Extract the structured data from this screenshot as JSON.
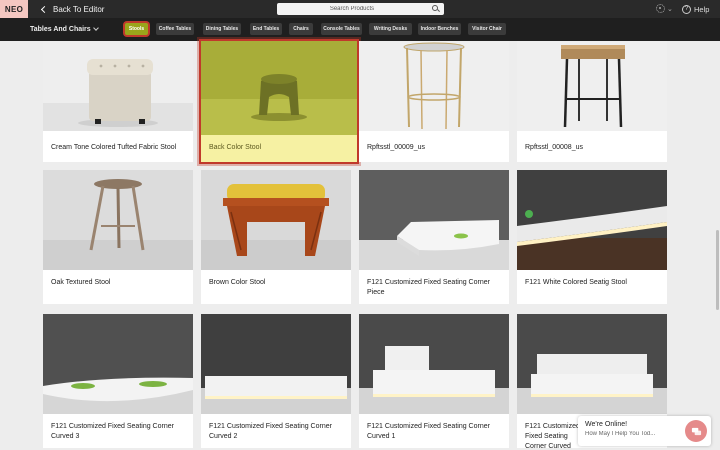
{
  "header": {
    "logo": "NEO",
    "back_label": "Back To Editor",
    "search_placeholder": "Search Products",
    "help_label": "Help"
  },
  "category_bar": {
    "selected_category": "Tables And Chairs",
    "tabs": [
      {
        "label": "Stools",
        "active": true
      },
      {
        "label": "Coffee Tables",
        "active": false
      },
      {
        "label": "Dining Tables",
        "active": false
      },
      {
        "label": "End Tables",
        "active": false
      },
      {
        "label": "Chairs",
        "active": false
      },
      {
        "label": "Console Tables",
        "active": false
      },
      {
        "label": "Writing Desks",
        "active": false
      },
      {
        "label": "Indoor Benches",
        "active": false
      },
      {
        "label": "Visitor Chair",
        "active": false
      }
    ]
  },
  "products": [
    {
      "name": "Cream Tone Colored Tufted Fabric Stool"
    },
    {
      "name": "Back Color Stool",
      "highlighted": true
    },
    {
      "name": "Rpftsstl_00009_us"
    },
    {
      "name": "Rpftsstl_00008_us"
    },
    {
      "name": "Oak Textured Stool"
    },
    {
      "name": "Brown Color Stool"
    },
    {
      "name": "F121 Customized Fixed Seating Corner Piece"
    },
    {
      "name": "F121 White Colored Seatig Stool"
    },
    {
      "name": "F121 Customized Fixed Seating Corner Curved 3"
    },
    {
      "name": "F121 Customized Fixed Seating Corner Curved 2"
    },
    {
      "name": "F121 Customized Fixed Seating Corner Curved 1"
    },
    {
      "name": "F121 Customized Fixed Seating Corner Curved"
    }
  ],
  "chat": {
    "title": "We're Online!",
    "subtitle": "How May I Help You Tod..."
  },
  "colors": {
    "accent": "#9aa51b",
    "highlight_outline": "#c0392b",
    "highlight_fill": "#f6f1a3"
  }
}
